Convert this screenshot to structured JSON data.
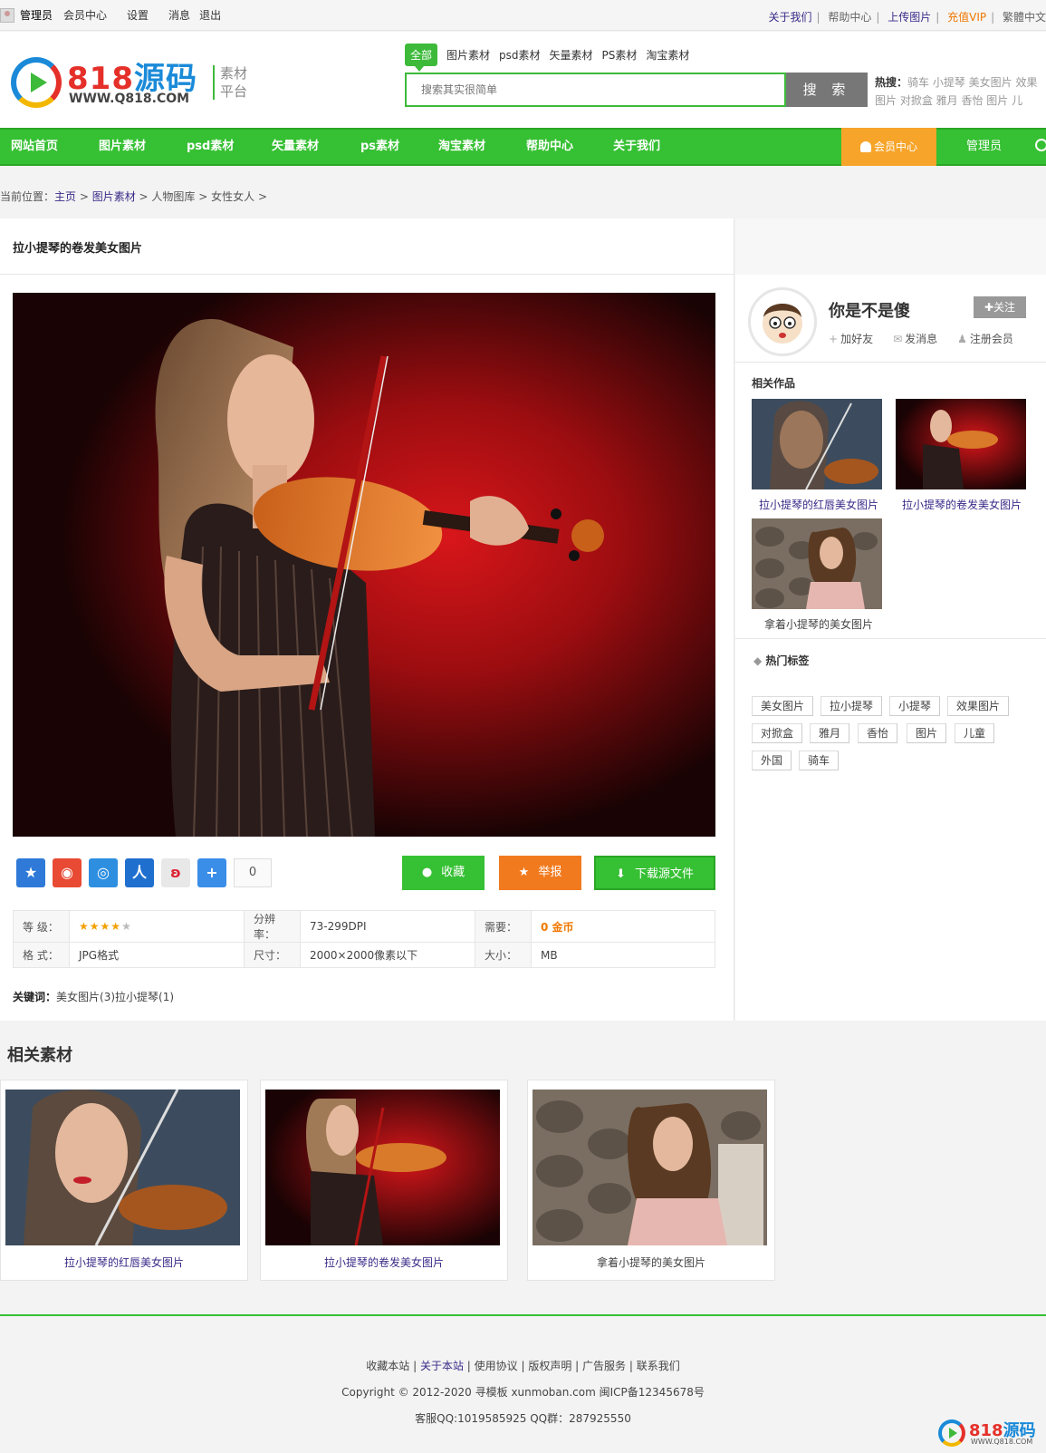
{
  "topbar": {
    "left": {
      "admin": "管理员",
      "member_center": "会员中心",
      "settings": "设置",
      "messages": "消息",
      "logout": "退出"
    },
    "right": {
      "about": "关于我们",
      "help": "帮助中心",
      "upload": "上传图片",
      "vip": "充值VIP",
      "lang": "繁體中文"
    }
  },
  "logo": {
    "text_red": "818",
    "text_blue": "源码",
    "url": "WWW.Q818.COM",
    "tag_line1": "素材",
    "tag_line2": "平台"
  },
  "search": {
    "tabs": [
      "全部",
      "图片素材",
      "psd素材",
      "矢量素材",
      "PS素材",
      "淘宝素材"
    ],
    "placeholder": "搜索其实很简单",
    "button": "搜 索",
    "hot_label": "热搜：",
    "hot_terms": "骑车 小提琴 美女图片 效果图片 对掀盒 雅月 香怡 图片 儿"
  },
  "nav": {
    "items": [
      "网站首页",
      "图片素材",
      "psd素材",
      "矢量素材",
      "ps素材",
      "淘宝素材",
      "帮助中心",
      "关于我们"
    ],
    "member": "会员中心",
    "admin": "管理员"
  },
  "breadcrumb": {
    "prefix": "当前位置：",
    "home": "主页",
    "cat": "图片素材",
    "sub": "人物图库",
    "leaf": "女性女人"
  },
  "detail": {
    "title": "拉小提琴的卷发美女图片",
    "share_count": "0",
    "buttons": {
      "fav": "收藏",
      "report": "举报",
      "download": "下载源文件"
    },
    "info": {
      "grade_label": "等 级：",
      "resolution_label": "分辨率：",
      "resolution": "73-299DPI",
      "need_label": "需要：",
      "need": "0 金币",
      "format_label": "格 式：",
      "format": "JPG格式",
      "size_label": "尺寸：",
      "size": "2000×2000像素以下",
      "filesize_label": "大小：",
      "filesize": "MB",
      "rating": 4,
      "rating_max": 5
    },
    "keywords_label": "关键词：",
    "keywords": "美女图片(3)拉小提琴(1)"
  },
  "sidebar": {
    "username": "你是不是傻",
    "follow": "✚关注",
    "actions": [
      "加好友",
      "发消息",
      "注册会员"
    ],
    "related_title": "相关作品",
    "related": [
      "拉小提琴的红唇美女图片",
      "拉小提琴的卷发美女图片",
      "拿着小提琴的美女图片"
    ],
    "tags_title": "热门标签",
    "tags": [
      "美女图片",
      "拉小提琴",
      "小提琴",
      "效果图片",
      "对掀盒",
      "雅月",
      "香怡",
      "图片",
      "儿童",
      "外国",
      "骑车"
    ]
  },
  "related_section": {
    "title": "相关素材",
    "items": [
      "拉小提琴的红唇美女图片",
      "拉小提琴的卷发美女图片",
      "拿着小提琴的美女图片"
    ]
  },
  "footer": {
    "links": [
      "收藏本站",
      "关于本站",
      "使用协议",
      "版权声明",
      "广告服务",
      "联系我们"
    ],
    "copyright": "Copyright © 2012-2020 寻模板 xunmoban.com 闽ICP备12345678号",
    "qq": "客服QQ:1019585925 QQ群：287925550",
    "logo_red": "818",
    "logo_blue": "源码",
    "logo_url": "WWW.Q818.COM"
  },
  "colors": {
    "brand_green": "#36c033",
    "accent_orange": "#f27a1e",
    "link_purple": "#3a2a88"
  }
}
